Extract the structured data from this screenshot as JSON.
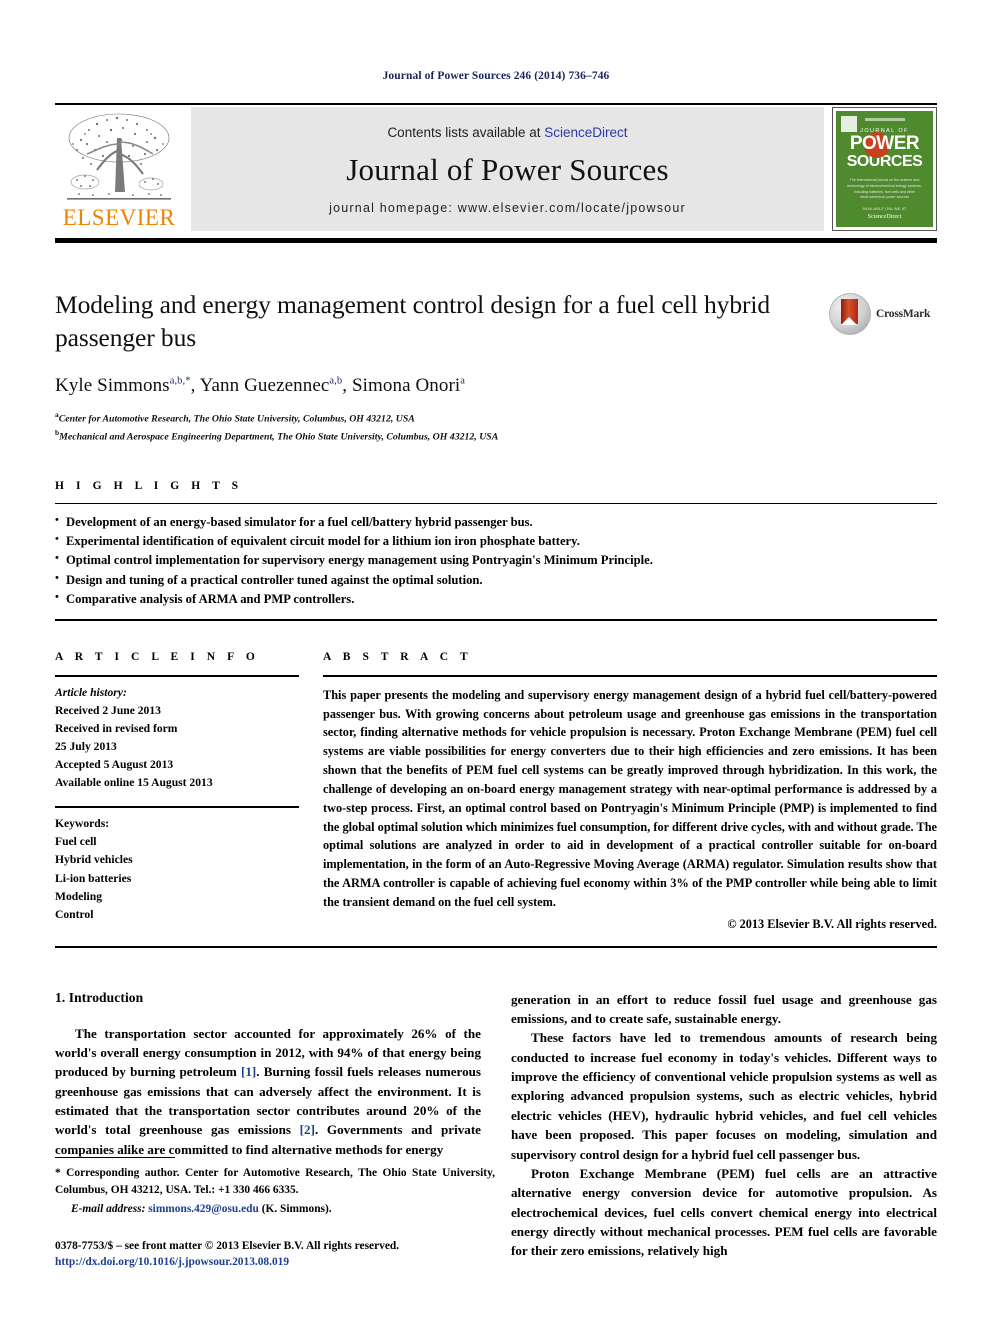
{
  "running_head": "Journal of Power Sources 246 (2014) 736–746",
  "masthead": {
    "publisher_name": "ELSEVIER",
    "contents_prefix": "Contents lists available at ",
    "contents_link": "ScienceDirect",
    "journal_title": "Journal of Power Sources",
    "homepage_line": "journal homepage: www.elsevier.com/locate/jpowsour",
    "cover": {
      "journal_of": "JOURNAL OF",
      "power": "POWER",
      "sources": "SOURCES",
      "blurb": "The international journal on the science and technology of electrochemical energy systems, including batteries, fuel cells and other electrochemical power sources",
      "footer_small": "AVAILABLE ONLINE AT",
      "footer_brand": "ScienceDirect"
    }
  },
  "title": "Modeling and energy management control design for a fuel cell hybrid passenger bus",
  "authors": [
    {
      "name": "Kyle Simmons",
      "marks": "a,b,*"
    },
    {
      "name": "Yann Guezennec",
      "marks": "a,b"
    },
    {
      "name": "Simona Onori",
      "marks": "a"
    }
  ],
  "affiliations": [
    {
      "mark": "a",
      "text": "Center for Automotive Research, The Ohio State University, Columbus, OH 43212, USA"
    },
    {
      "mark": "b",
      "text": "Mechanical and Aerospace Engineering Department, The Ohio State University, Columbus, OH 43212, USA"
    }
  ],
  "crossmark_label": "CrossMark",
  "highlights": {
    "heading": "H I G H L I G H T S",
    "items": [
      "Development of an energy-based simulator for a fuel cell/battery hybrid passenger bus.",
      "Experimental identification of equivalent circuit model for a lithium ion iron phosphate battery.",
      "Optimal control implementation for supervisory energy management using Pontryagin's Minimum Principle.",
      "Design and tuning of a practical controller tuned against the optimal solution.",
      "Comparative analysis of ARMA and PMP controllers."
    ]
  },
  "article_info": {
    "heading": "A R T I C L E  I N F O",
    "history_label": "Article history:",
    "history": [
      "Received 2 June 2013",
      "Received in revised form",
      "25 July 2013",
      "Accepted 5 August 2013",
      "Available online 15 August 2013"
    ],
    "keywords_label": "Keywords:",
    "keywords": [
      "Fuel cell",
      "Hybrid vehicles",
      "Li-ion batteries",
      "Modeling",
      "Control"
    ]
  },
  "abstract": {
    "heading": "A B S T R A C T",
    "text": "This paper presents the modeling and supervisory energy management design of a hybrid fuel cell/battery-powered passenger bus. With growing concerns about petroleum usage and greenhouse gas emissions in the transportation sector, finding alternative methods for vehicle propulsion is necessary. Proton Exchange Membrane (PEM) fuel cell systems are viable possibilities for energy converters due to their high efficiencies and zero emissions. It has been shown that the benefits of PEM fuel cell systems can be greatly improved through hybridization. In this work, the challenge of developing an on-board energy management strategy with near-optimal performance is addressed by a two-step process. First, an optimal control based on Pontryagin's Minimum Principle (PMP) is implemented to find the global optimal solution which minimizes fuel consumption, for different drive cycles, with and without grade. The optimal solutions are analyzed in order to aid in development of a practical controller suitable for on-board implementation, in the form of an Auto-Regressive Moving Average (ARMA) regulator. Simulation results show that the ARMA controller is capable of achieving fuel economy within 3% of the PMP controller while being able to limit the transient demand on the fuel cell system.",
    "copyright": "© 2013 Elsevier B.V. All rights reserved."
  },
  "body": {
    "section_number_title": "1.  Introduction",
    "left_para_1_a": "The transportation sector accounted for approximately 26% of the world's overall energy consumption in 2012, with 94% of that energy being produced by burning petroleum ",
    "left_para_1_ref1": "[1]",
    "left_para_1_b": ". Burning fossil fuels releases numerous greenhouse gas emissions that can adversely affect the environment. It is estimated that the transportation sector contributes around 20% of the world's total greenhouse gas emissions ",
    "left_para_1_ref2": "[2]",
    "left_para_1_c": ". Governments and private companies alike are committed to find alternative methods for energy",
    "right_para_1": "generation in an effort to reduce fossil fuel usage and greenhouse gas emissions, and to create safe, sustainable energy.",
    "right_para_2": "These factors have led to tremendous amounts of research being conducted to increase fuel economy in today's vehicles. Different ways to improve the efficiency of conventional vehicle propulsion systems as well as exploring advanced propulsion systems, such as electric vehicles, hybrid electric vehicles (HEV), hydraulic hybrid vehicles, and fuel cell vehicles have been proposed. This paper focuses on modeling, simulation and supervisory control design for a hybrid fuel cell passenger bus.",
    "right_para_3": "Proton Exchange Membrane (PEM) fuel cells are an attractive alternative energy conversion device for automotive propulsion. As electrochemical devices, fuel cells convert chemical energy into electrical energy directly without mechanical processes. PEM fuel cells are favorable for their zero emissions, relatively high"
  },
  "footnote": {
    "corresponding": "* Corresponding author. Center for Automotive Research, The Ohio State University, Columbus, OH 43212, USA. Tel.: +1 330 466 6335.",
    "email_label": "E-mail address:",
    "email": "simmons.429@osu.edu",
    "email_suffix": "(K. Simmons).",
    "imprint_line": "0378-7753/$ – see front matter © 2013 Elsevier B.V. All rights reserved.",
    "doi_line": "http://dx.doi.org/10.1016/j.jpowsour.2013.08.019"
  },
  "colors": {
    "link_blue": "#2b39a8",
    "ref_blue": "#1c3f94",
    "elsevier_orange": "#ef8200",
    "cover_green": "#4f8a2e",
    "cover_red": "#c8411f"
  }
}
